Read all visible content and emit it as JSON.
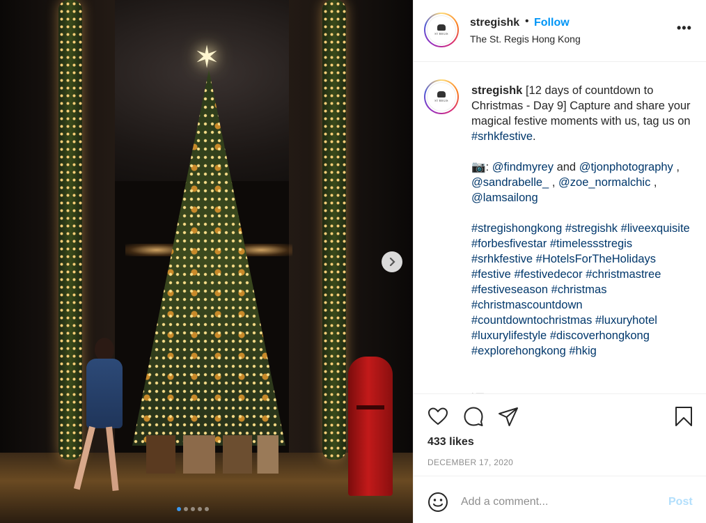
{
  "post": {
    "image_alt_elements": {
      "next_icon": "chevron-right-icon"
    },
    "carousel": {
      "total": 5,
      "active": 1
    }
  },
  "header": {
    "username": "stregishk",
    "separator": "•",
    "follow_label": "Follow",
    "location": "The St. Regis Hong Kong",
    "more_label": "•••",
    "avatar_text": "ST REGIS"
  },
  "caption": {
    "username": "stregishk",
    "text_line1": "[12 days of countdown to Christmas - Day 9] Capture and share your magical festive moments with us, tag us on",
    "text_tag": "#srhkfestive",
    "text_end": ".",
    "credit_prefix": "📷: ",
    "credits": [
      "@findmyrey",
      "@tjonphotography",
      "@sandrabelle_",
      "@zoe_normalchic",
      "@lamsailong"
    ],
    "credit_and": " and ",
    "credit_sep": " , ",
    "hashtags": [
      "#stregishongkong",
      "#stregishk",
      "#liveexquisite",
      "#forbesfivestar",
      "#timelessstregis",
      "#srhkfestive",
      "#HotelsForTheHolidays",
      "#festive",
      "#festivedecor",
      "#christmastree",
      "#festiveseason",
      "#christmas",
      "#christmascountdown",
      "#countdowntochristmas",
      "#luxuryhotel",
      "#luxurylifestyle",
      "#discoverhongkong",
      "#explorehongkong",
      "#hkig"
    ]
  },
  "actions": {
    "like_icon": "heart-icon",
    "comment_icon": "comment-icon",
    "share_icon": "share-icon",
    "save_icon": "bookmark-icon",
    "likes": "433 likes",
    "date": "DECEMBER 17, 2020"
  },
  "comment": {
    "placeholder": "Add a comment...",
    "post_label": "Post",
    "emoji_icon": "smiley-icon"
  },
  "colors": {
    "link_blue": "#0095f6",
    "hashtag": "#00376b",
    "post_disabled": "#b2dffc",
    "muted": "#8e8e8e"
  }
}
